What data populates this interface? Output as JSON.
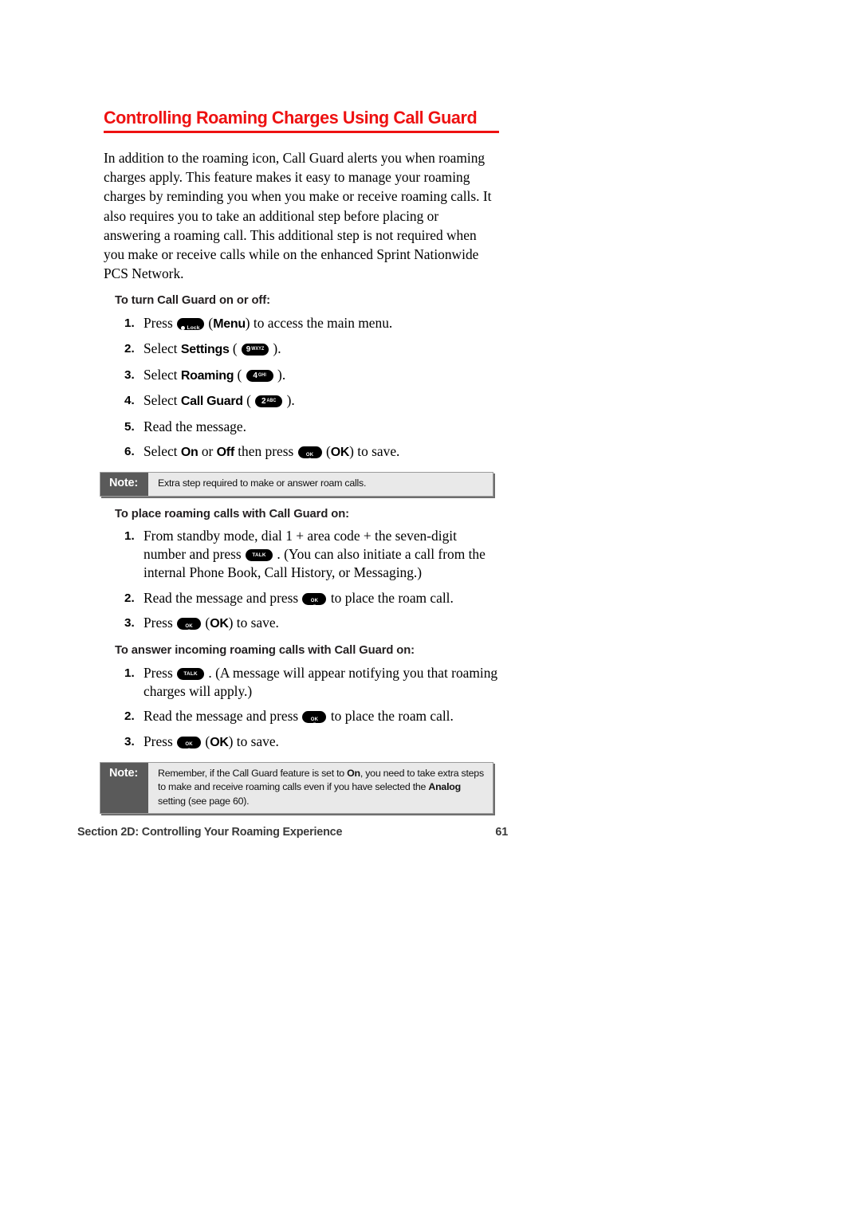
{
  "page": {
    "title": "Controlling Roaming Charges Using Call Guard",
    "title_color": "#ee1111",
    "intro": "In addition to the roaming icon, Call Guard alerts you when roaming charges apply. This feature makes it easy to manage your roaming charges by reminding you when you make or receive roaming calls. It also requires you to take an additional step before placing or answering a roaming call. This additional step is not required when you make or receive calls while on the enhanced Sprint Nationwide PCS Network."
  },
  "sections": [
    {
      "heading": "To turn Call Guard on or off:",
      "steps": [
        {
          "num": "1.",
          "pre": "Press ",
          "key": {
            "type": "dot",
            "label": "Lock"
          },
          "post": " (Menu) to access the main menu.",
          "post_bold": "Menu"
        },
        {
          "num": "2.",
          "pre": "Select ",
          "bold": "Settings",
          "mid": " ( ",
          "key": {
            "type": "num",
            "main": "9",
            "sub": "WXYZ"
          },
          "post": " )."
        },
        {
          "num": "3.",
          "pre": "Select ",
          "bold": "Roaming",
          "mid": " ( ",
          "key": {
            "type": "num",
            "main": "4",
            "sub": "GHI"
          },
          "post": " )."
        },
        {
          "num": "4.",
          "pre": "Select ",
          "bold": "Call Guard",
          "mid": " ( ",
          "key": {
            "type": "num",
            "main": "2",
            "sub": "ABC"
          },
          "post": " )."
        },
        {
          "num": "5.",
          "text": "Read the message."
        },
        {
          "num": "6.",
          "pre": "Select ",
          "bold1": "On",
          "mid1": " or ",
          "bold2": "Off",
          "mid2": " then press ",
          "key": {
            "type": "ok",
            "l1": "OK",
            "l2": "≡"
          },
          "post": " (OK) to save.",
          "post_bold": "OK"
        }
      ]
    },
    {
      "heading": "To place roaming calls with Call Guard on:",
      "steps": [
        {
          "num": "1.",
          "pre": "From standby mode, dial 1 + area code + the seven-digit number and press ",
          "key": {
            "type": "talk",
            "label": "TALK"
          },
          "post": " . (You can also initiate a call from the internal Phone Book, Call History, or Messaging.)"
        },
        {
          "num": "2.",
          "pre": "Read the message and press ",
          "key": {
            "type": "ok",
            "l1": "OK",
            "l2": "≡"
          },
          "post": " to place the roam call."
        },
        {
          "num": "3.",
          "pre": "Press ",
          "key": {
            "type": "ok",
            "l1": "OK",
            "l2": "≡"
          },
          "post": " (OK) to save.",
          "post_bold": "OK"
        }
      ]
    },
    {
      "heading": "To answer incoming roaming calls with Call Guard on:",
      "steps": [
        {
          "num": "1.",
          "pre": "Press ",
          "key": {
            "type": "talk",
            "label": "TALK"
          },
          "post": " . (A message will appear notifying you that roaming charges will apply.)"
        },
        {
          "num": "2.",
          "pre": "Read the message and press ",
          "key": {
            "type": "ok",
            "l1": "OK",
            "l2": "≡"
          },
          "post": " to place the roam call."
        },
        {
          "num": "3.",
          "pre": "Press ",
          "key": {
            "type": "ok",
            "l1": "OK",
            "l2": "≡"
          },
          "post": " (OK) to save.",
          "post_bold": "OK"
        }
      ]
    }
  ],
  "notes": [
    {
      "label": "Note:",
      "body_plain": "Extra step required to make or answer roam calls."
    },
    {
      "label": "Note:",
      "body_part1": "Remember, if the Call Guard feature is set to ",
      "body_bold1": "On",
      "body_part2": ", you need to take extra steps to make and receive roaming calls even if you have selected the ",
      "body_bold2": "Analog",
      "body_part3": " setting (see page 60)."
    }
  ],
  "footer": {
    "section": "Section 2D: Controlling Your Roaming Experience",
    "page_number": "61"
  },
  "colors": {
    "title_red": "#ee1111",
    "note_label_gray": "#5a5a5a",
    "note_body_gray": "#e9e9e9",
    "footer_gray": "#3a3a3a"
  }
}
